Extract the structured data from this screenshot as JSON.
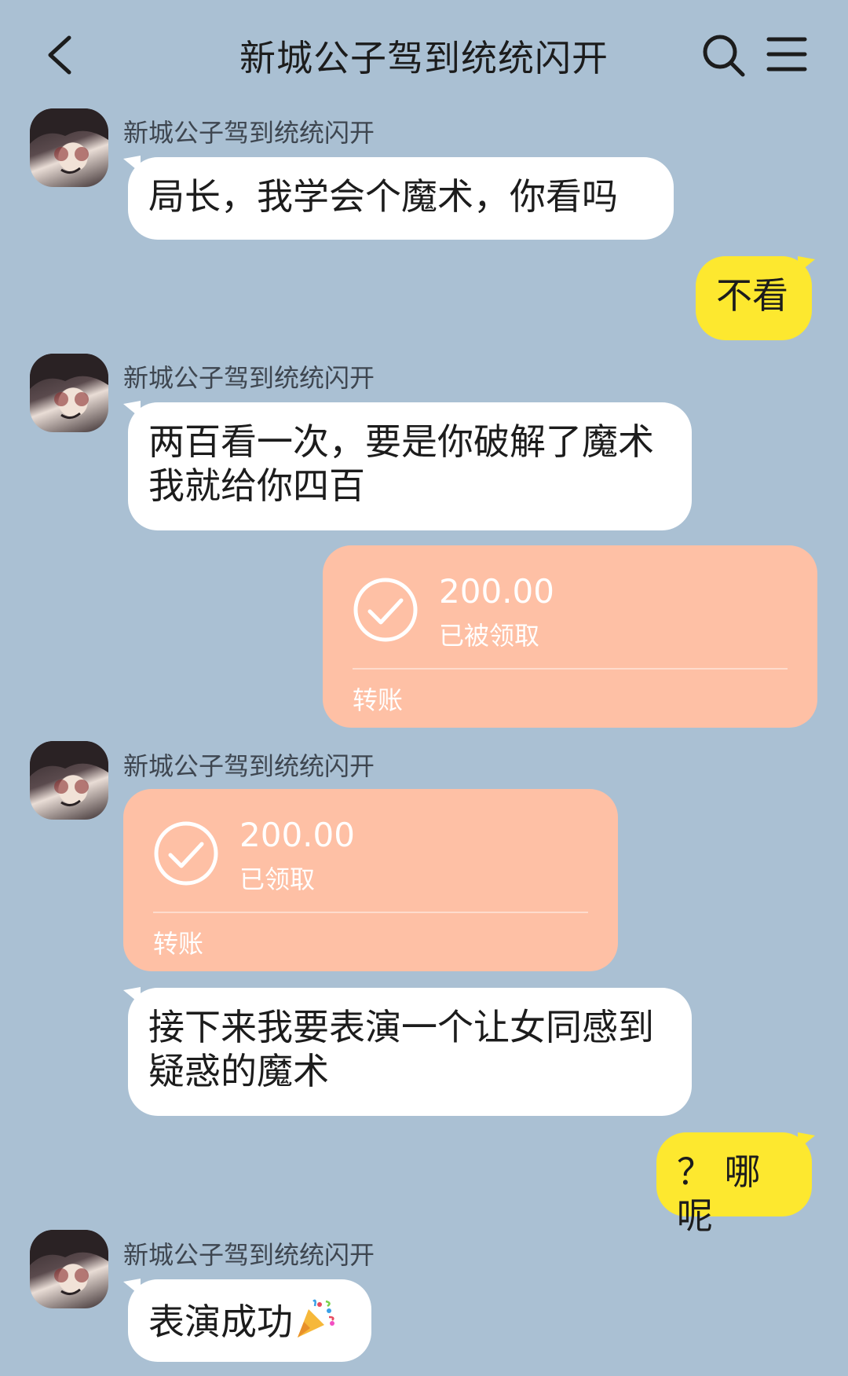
{
  "header": {
    "title": "新城公子驾到统统闪开"
  },
  "messages": [
    {
      "sender": "新城公子驾到统统闪开",
      "text": "局长，我学会个魔术，你看吗"
    },
    {
      "text": "不看"
    },
    {
      "sender": "新城公子驾到统统闪开",
      "text": "两百看一次，要是你破解了魔术我就给你四百"
    },
    {
      "amount": "200.00",
      "status": "已被领取",
      "type": "转账"
    },
    {
      "sender": "新城公子驾到统统闪开",
      "amount": "200.00",
      "status": "已领取",
      "type": "转账"
    },
    {
      "text": "接下来我要表演一个让女同感到疑惑的魔术"
    },
    {
      "text": "？ 哪呢"
    },
    {
      "sender": "新城公子驾到统统闪开",
      "text": "表演成功",
      "emoji": "party-popper-icon"
    }
  ],
  "colors": {
    "background": "#aac0d3",
    "incoming_bubble": "#ffffff",
    "outgoing_bubble": "#fde82f",
    "transfer_card": "#fec0a5"
  }
}
